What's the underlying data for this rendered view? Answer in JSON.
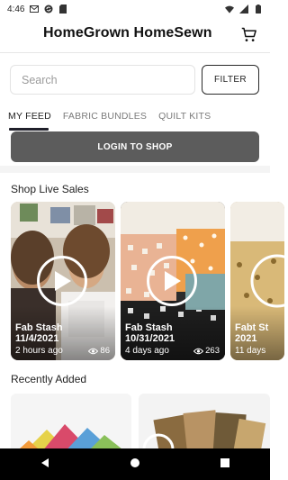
{
  "status_bar": {
    "time": "4:46",
    "icons_left": [
      "gmail-icon",
      "sync-icon",
      "sd-card-icon"
    ],
    "icons_right": [
      "wifi-icon",
      "signal-icon",
      "battery-icon"
    ]
  },
  "header": {
    "title": "HomeGrown HomeSewn",
    "cart_icon": "cart-icon"
  },
  "search": {
    "placeholder": "Search",
    "value": "",
    "filter_label": "FILTER"
  },
  "tabs": [
    {
      "label": "MY FEED",
      "active": true
    },
    {
      "label": "FABRIC BUNDLES",
      "active": false
    },
    {
      "label": "QUILT KITS",
      "active": false
    }
  ],
  "login_button": "LOGIN TO SHOP",
  "live_sales": {
    "title": "Shop Live Sales",
    "items": [
      {
        "name": "Fab Stash",
        "date": "11/4/2021",
        "ago": "2 hours ago",
        "views": "86"
      },
      {
        "name": "Fab Stash",
        "date": "10/31/2021",
        "ago": "4 days ago",
        "views": "263"
      },
      {
        "name": "Fabt St",
        "date": "2021",
        "ago": "11 days",
        "views": ""
      }
    ]
  },
  "recently_added": {
    "title": "Recently Added"
  },
  "nav": [
    "back-icon",
    "home-icon",
    "recents-icon"
  ],
  "colors": {
    "login_bg": "#5c5c5c",
    "tab_indicator": "#1f1f2a",
    "accent_text": "#111111"
  }
}
